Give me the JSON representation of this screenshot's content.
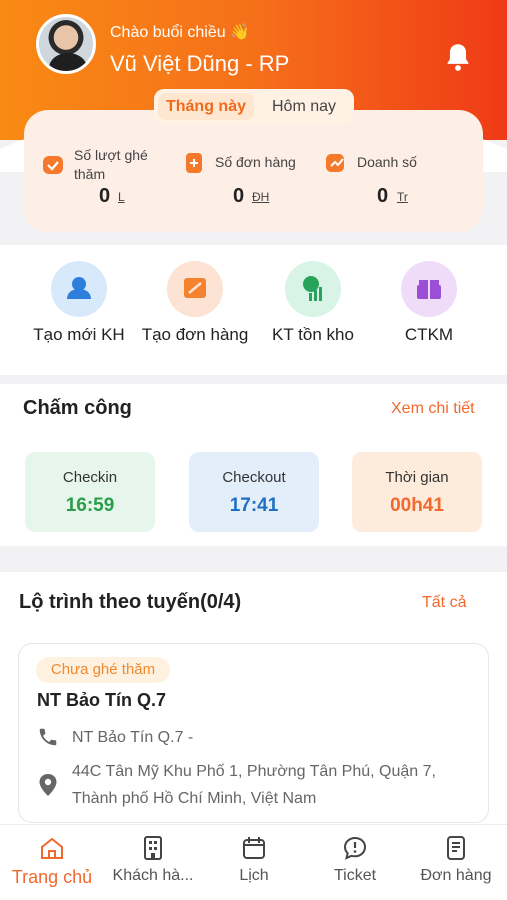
{
  "header": {
    "greeting": "Chào buổi chiều 👋",
    "user_name": "Vũ Việt Dũng - RP",
    "tabs": [
      {
        "label": "Tháng này",
        "active": true
      },
      {
        "label": "Hôm nay",
        "active": false
      }
    ]
  },
  "stats": [
    {
      "label": "Số lượt ghé thăm",
      "value": "0",
      "unit": "L",
      "icon": "visit-icon"
    },
    {
      "label": "Số đơn hàng",
      "value": "0",
      "unit": "ĐH",
      "icon": "order-add-icon"
    },
    {
      "label": "Doanh số",
      "value": "0",
      "unit": "Tr",
      "icon": "revenue-icon"
    }
  ],
  "quick_actions": [
    {
      "label": "Tạo mới KH",
      "icon": "person-icon",
      "color": "#d7e9fb"
    },
    {
      "label": "Tạo đơn hàng",
      "icon": "edit-doc-icon",
      "color": "#fde3d3"
    },
    {
      "label": "KT tồn kho",
      "icon": "inventory-icon",
      "color": "#d8f4e6"
    },
    {
      "label": "CTKM",
      "icon": "gift-icon",
      "color": "#eedcf9"
    }
  ],
  "attendance": {
    "title": "Chấm công",
    "link": "Xem chi tiết",
    "items": [
      {
        "label": "Checkin",
        "value": "16:59",
        "color": "#2a9d4a",
        "bg": "#e7f6ec"
      },
      {
        "label": "Checkout",
        "value": "17:41",
        "color": "#1f6fc4",
        "bg": "#e3eefb"
      },
      {
        "label": "Thời gian",
        "value": "00h41",
        "color": "#f2682d",
        "bg": "#fdebdc"
      }
    ]
  },
  "route": {
    "title": "Lộ trình theo tuyến(0/4)",
    "link": "Tất cả",
    "card": {
      "status": "Chưa ghé thăm",
      "name": "NT Bảo Tín Q.7",
      "phone_line": "NT Bảo Tín Q.7 -",
      "address_line1": "44C Tân Mỹ Khu Phố 1, Phường Tân Phú, Quận 7,",
      "address_line2": "Thành phố Hồ Chí Minh, Việt Nam"
    }
  },
  "bottom_nav": [
    {
      "label": "Trang chủ",
      "icon": "home-icon",
      "active": true
    },
    {
      "label": "Khách hà...",
      "icon": "building-icon",
      "active": false
    },
    {
      "label": "Lịch",
      "icon": "calendar-icon",
      "active": false
    },
    {
      "label": "Ticket",
      "icon": "chat-alert-icon",
      "active": false
    },
    {
      "label": "Đơn hàng",
      "icon": "document-icon",
      "active": false
    }
  ],
  "colors": {
    "brand": "#f26a1b",
    "accent": "#f2682d"
  }
}
